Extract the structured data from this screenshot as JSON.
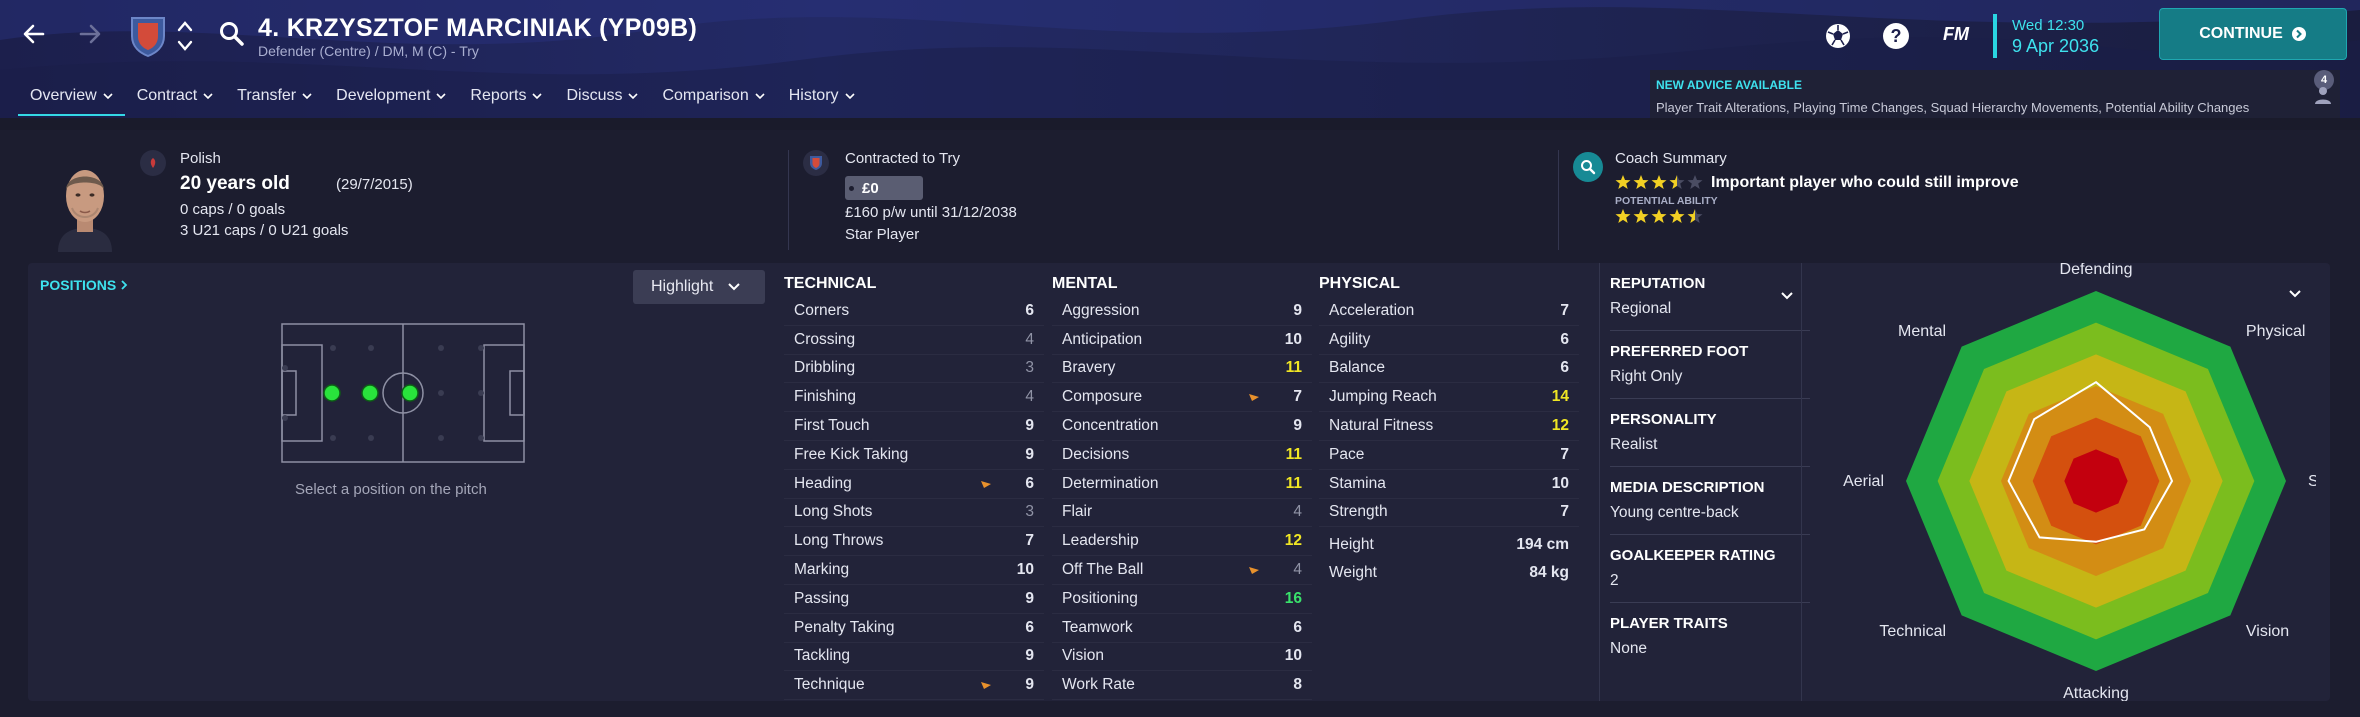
{
  "header": {
    "title": "4. KRZYSZTOF MARCINIAK (YP09B)",
    "subtitle": "Defender (Centre) / DM, M (C) - Try",
    "fm_label": "FM",
    "date_day": "Wed 12:30",
    "date_full": "9 Apr 2036",
    "continue_label": "CONTINUE",
    "icons": [
      "back-arrow-icon",
      "forward-arrow-icon",
      "club-badge-icon",
      "up-down-icon",
      "search-icon",
      "ball-icon",
      "help-icon",
      "continue-arrow-icon"
    ],
    "accent_color": "#34d8e6",
    "continue_color": "#157c86"
  },
  "tabs": [
    {
      "label": "Overview"
    },
    {
      "label": "Contract"
    },
    {
      "label": "Transfer"
    },
    {
      "label": "Development"
    },
    {
      "label": "Reports"
    },
    {
      "label": "Discuss"
    },
    {
      "label": "Comparison"
    },
    {
      "label": "History"
    }
  ],
  "advice": {
    "title": "NEW ADVICE AVAILABLE",
    "text": "Player Trait Alterations, Playing Time Changes, Squad Hierarchy Movements, Potential Ability Changes",
    "count": "4"
  },
  "summary": {
    "nationality": "Polish",
    "age": "20 years old",
    "dob": "(29/7/2015)",
    "caps": "0 caps / 0 goals",
    "u21caps": "3 U21 caps / 0 U21 goals",
    "contract_title": "Contracted to Try",
    "value": "£0",
    "wage": "£160 p/w until 31/12/2038",
    "status": "Star Player",
    "coach_title": "Coach Summary",
    "coach_text": "Important player who could still improve",
    "potential_label": "POTENTIAL ABILITY",
    "current_stars": 3.5,
    "potential_stars": 4.5
  },
  "positions": {
    "label": "POSITIONS",
    "highlight_label": "Highlight",
    "hint": "Select a position on the pitch"
  },
  "technical": {
    "heading": "TECHNICAL",
    "items": [
      {
        "name": "Corners",
        "value": "6",
        "tone": "n",
        "arrow": false
      },
      {
        "name": "Crossing",
        "value": "4",
        "tone": "lo",
        "arrow": false
      },
      {
        "name": "Dribbling",
        "value": "3",
        "tone": "lo",
        "arrow": false
      },
      {
        "name": "Finishing",
        "value": "4",
        "tone": "lo",
        "arrow": false
      },
      {
        "name": "First Touch",
        "value": "9",
        "tone": "n",
        "arrow": false
      },
      {
        "name": "Free Kick Taking",
        "value": "9",
        "tone": "n",
        "arrow": false
      },
      {
        "name": "Heading",
        "value": "6",
        "tone": "n",
        "arrow": true
      },
      {
        "name": "Long Shots",
        "value": "3",
        "tone": "lo",
        "arrow": false
      },
      {
        "name": "Long Throws",
        "value": "7",
        "tone": "n",
        "arrow": false
      },
      {
        "name": "Marking",
        "value": "10",
        "tone": "n",
        "arrow": false
      },
      {
        "name": "Passing",
        "value": "9",
        "tone": "n",
        "arrow": false
      },
      {
        "name": "Penalty Taking",
        "value": "6",
        "tone": "n",
        "arrow": false
      },
      {
        "name": "Tackling",
        "value": "9",
        "tone": "n",
        "arrow": false
      },
      {
        "name": "Technique",
        "value": "9",
        "tone": "n",
        "arrow": true
      }
    ]
  },
  "mental": {
    "heading": "MENTAL",
    "items": [
      {
        "name": "Aggression",
        "value": "9",
        "tone": "n",
        "arrow": false
      },
      {
        "name": "Anticipation",
        "value": "10",
        "tone": "n",
        "arrow": false
      },
      {
        "name": "Bravery",
        "value": "11",
        "tone": "hi",
        "arrow": false
      },
      {
        "name": "Composure",
        "value": "7",
        "tone": "n",
        "arrow": true
      },
      {
        "name": "Concentration",
        "value": "9",
        "tone": "n",
        "arrow": false
      },
      {
        "name": "Decisions",
        "value": "11",
        "tone": "hi",
        "arrow": false
      },
      {
        "name": "Determination",
        "value": "11",
        "tone": "hi",
        "arrow": false
      },
      {
        "name": "Flair",
        "value": "4",
        "tone": "lo",
        "arrow": false
      },
      {
        "name": "Leadership",
        "value": "12",
        "tone": "hi",
        "arrow": false
      },
      {
        "name": "Off The Ball",
        "value": "4",
        "tone": "lo",
        "arrow": true
      },
      {
        "name": "Positioning",
        "value": "16",
        "tone": "hi2",
        "arrow": false
      },
      {
        "name": "Teamwork",
        "value": "6",
        "tone": "n",
        "arrow": false
      },
      {
        "name": "Vision",
        "value": "10",
        "tone": "n",
        "arrow": false
      },
      {
        "name": "Work Rate",
        "value": "8",
        "tone": "n",
        "arrow": false
      }
    ]
  },
  "physical": {
    "heading": "PHYSICAL",
    "items": [
      {
        "name": "Acceleration",
        "value": "7",
        "tone": "n",
        "arrow": false
      },
      {
        "name": "Agility",
        "value": "6",
        "tone": "n",
        "arrow": false
      },
      {
        "name": "Balance",
        "value": "6",
        "tone": "n",
        "arrow": false
      },
      {
        "name": "Jumping Reach",
        "value": "14",
        "tone": "hi",
        "arrow": false
      },
      {
        "name": "Natural Fitness",
        "value": "12",
        "tone": "hi",
        "arrow": false
      },
      {
        "name": "Pace",
        "value": "7",
        "tone": "n",
        "arrow": false
      },
      {
        "name": "Stamina",
        "value": "10",
        "tone": "n",
        "arrow": false
      },
      {
        "name": "Strength",
        "value": "7",
        "tone": "n",
        "arrow": false
      }
    ],
    "height_label": "Height",
    "height": "194 cm",
    "weight_label": "Weight",
    "weight": "84 kg"
  },
  "info": [
    {
      "heading": "REPUTATION",
      "value": "Regional"
    },
    {
      "heading": "PREFERRED FOOT",
      "value": "Right Only"
    },
    {
      "heading": "PERSONALITY",
      "value": "Realist"
    },
    {
      "heading": "MEDIA DESCRIPTION",
      "value": "Young centre-back"
    },
    {
      "heading": "GOALKEEPER RATING",
      "value": "2"
    },
    {
      "heading": "PLAYER TRAITS",
      "value": "None"
    }
  ],
  "radar": {
    "axes": [
      "Defending",
      "Physical",
      "Speed",
      "Vision",
      "Attacking",
      "Technical",
      "Aerial",
      "Mental"
    ],
    "player_values": [
      0.52,
      0.4,
      0.4,
      0.36,
      0.32,
      0.42,
      0.46,
      0.46
    ],
    "band_colors": [
      "#1fa842",
      "#7bbd1e",
      "#c6b615",
      "#d38d14",
      "#d4500e",
      "#c3000e"
    ]
  }
}
